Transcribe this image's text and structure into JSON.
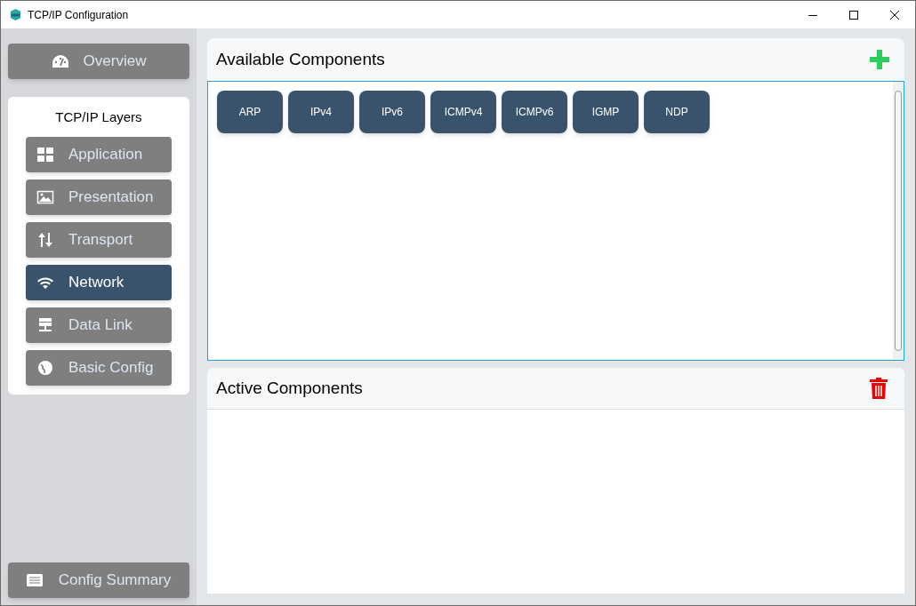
{
  "window": {
    "title": "TCP/IP Configuration"
  },
  "overview_button": {
    "label": "Overview"
  },
  "layers": {
    "title": "TCP/IP Layers",
    "items": [
      {
        "label": "Application",
        "kind": "grid",
        "selected": false
      },
      {
        "label": "Presentation",
        "kind": "image",
        "selected": false
      },
      {
        "label": "Transport",
        "kind": "arrows",
        "selected": false
      },
      {
        "label": "Network",
        "kind": "wifi",
        "selected": true
      },
      {
        "label": "Data Link",
        "kind": "server",
        "selected": false
      },
      {
        "label": "Basic Config",
        "kind": "globe",
        "selected": false
      }
    ]
  },
  "summary_button": {
    "label": "Config Summary"
  },
  "available": {
    "title": "Available Components",
    "components": [
      "ARP",
      "IPv4",
      "IPv6",
      "ICMPv4",
      "ICMPv6",
      "IGMP",
      "NDP"
    ]
  },
  "active": {
    "title": "Active Components"
  }
}
